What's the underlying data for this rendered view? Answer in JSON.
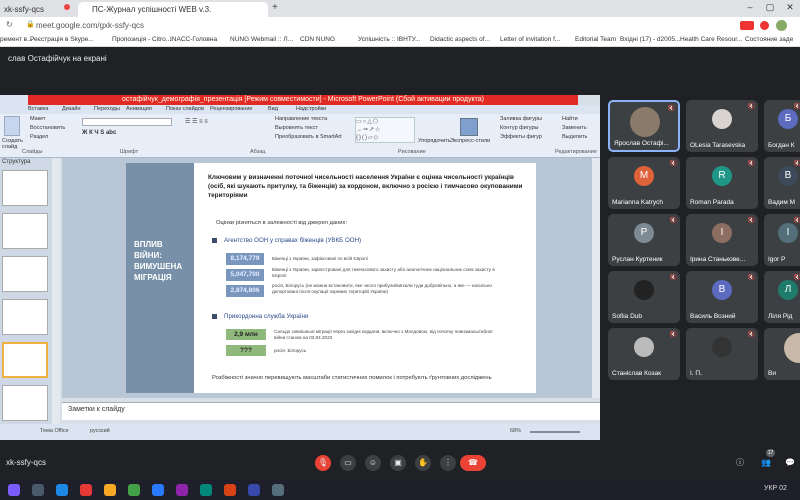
{
  "browser": {
    "tab1": "xk-ssfy-qcs",
    "tab2": "ПС-Журнал успішності WEB v.3.",
    "url": "meet.google.com/gxk-ssfy-qcs",
    "bookmarks": [
      "ремент в...",
      "Реєстрація в Skype...",
      "Пропозиція - Citro...",
      "INACC-Головна",
      "NUNG Webmail :: Л...",
      "CDN NUNG",
      "Успішність :: ІВНТУ...",
      "Didactic aspects of...",
      "Letter of invitation f...",
      "Editorial Team",
      "Вхідні (17) - d2005...",
      "Health Care Resour...",
      "Состояние заде"
    ]
  },
  "meet": {
    "presenter": "слав Остафійчук на екрані",
    "meeting_code": "xk-ssfy-qcs",
    "people_count": "17"
  },
  "powerpoint": {
    "title": "остафійчук_демографія_презентація [Режим совместимости] - Microsoft PowerPoint (Сбой активации продукта)",
    "tabs": [
      "Вставка",
      "Дизайн",
      "Переходы",
      "Анимация",
      "Показ слайдов",
      "Рецензирование",
      "Вид",
      "Надстройки"
    ],
    "ribbon_left": [
      "Макет",
      "Восстановить",
      "Раздел",
      "Создать слайд",
      "Слайды"
    ],
    "ribbon_paragraph": [
      "Направление текста",
      "Выровнять текст",
      "Преобразовать в SmartArt"
    ],
    "ribbon_groups": [
      "Шрифт",
      "Абзац",
      "Рисование",
      "Экспресс-стили",
      "Редактирование"
    ],
    "ribbon_right": [
      "Заливка фигуры",
      "Контур фигуры",
      "Эффекты фигур",
      "Найти",
      "Заменить",
      "Выделить"
    ],
    "draw_label": "Упорядочить",
    "pane_tab": "Структура",
    "notes": "Заметки к слайду",
    "status": [
      "Тема Office",
      "русский",
      "68%"
    ]
  },
  "slide": {
    "side_label": "ВПЛИВ ВІЙНИ: ВИМУШЕНА МІГРАЦІЯ",
    "title": "Ключовим у визначенні поточної чисельності населення України є оцінка чисельності українців (осіб, які шукають притулку, та біженців) за кордоном, включно з росією і тимчасово окупованими територіями",
    "subtitle": "Оцінки різняться в залежності від джерел даних:",
    "source1": "Агентство ООН у справах біженців (УВКБ ООН)",
    "rows1": [
      {
        "value": "8,174,779",
        "text": "Біженці з України, зафіксовані по всій Європі"
      },
      {
        "value": "5,047,700",
        "text": "Біженці з України, зареєстровані для тимчасового захисту або аналогічних національних схем захисту в Європі"
      },
      {
        "value": "2,874,806",
        "text": "росія, Білорусь (не можна встановити, яке число прибули/виїхали туди добровільно, а яке — насильно депортовані після окупації окремих територій України)"
      }
    ],
    "source2": "Прикордонна служба України",
    "rows2": [
      {
        "value": "2,9 млн",
        "text": "Сальдо зовнішньої міграції через західні кордони, включно з Молдовою, від початку повномасштабної війни станом на 03.04.2023"
      },
      {
        "value": "???",
        "text": "росія, Білорусь"
      }
    ],
    "footer": "Розбіжності значно перевищують масштаби статистичних помилок і потребують ґрунтовних досліджень"
  },
  "participants": [
    {
      "name": "Ярослав Остафі...",
      "initial": "",
      "color": "#8a7a6a"
    },
    {
      "name": "OLesia Tarasevska",
      "initial": "",
      "color": "#d9d4cf"
    },
    {
      "name": "Богдан К",
      "initial": "Б",
      "color": "#5c6bc0"
    },
    {
      "name": "Marianna Katrych",
      "initial": "M",
      "color": "#e0623a"
    },
    {
      "name": "Roman Parada",
      "initial": "R",
      "color": "#1e9688"
    },
    {
      "name": "Вадим М",
      "initial": "В",
      "color": "#3c4a5a"
    },
    {
      "name": "Руслан Куртеник",
      "initial": "Р",
      "color": "#7d8a93"
    },
    {
      "name": "Ірина Станькове...",
      "initial": "І",
      "color": "#8d6e63"
    },
    {
      "name": "Igor P",
      "initial": "I",
      "color": "#546e7a"
    },
    {
      "name": "Sofiia Dub",
      "initial": "",
      "color": "#222"
    },
    {
      "name": "Василь Возний",
      "initial": "В",
      "color": "#5c6bc0"
    },
    {
      "name": "Ліля Рід",
      "initial": "Л",
      "color": "#1e7a6a"
    },
    {
      "name": "Станіслав Козак",
      "initial": "",
      "color": "#bbb"
    },
    {
      "name": "І. П.",
      "initial": "",
      "color": "#333"
    },
    {
      "name": "Ви",
      "initial": "",
      "color": "#c9b9a8"
    }
  ],
  "taskbar": {
    "lang": "УКР",
    "time": "02"
  }
}
